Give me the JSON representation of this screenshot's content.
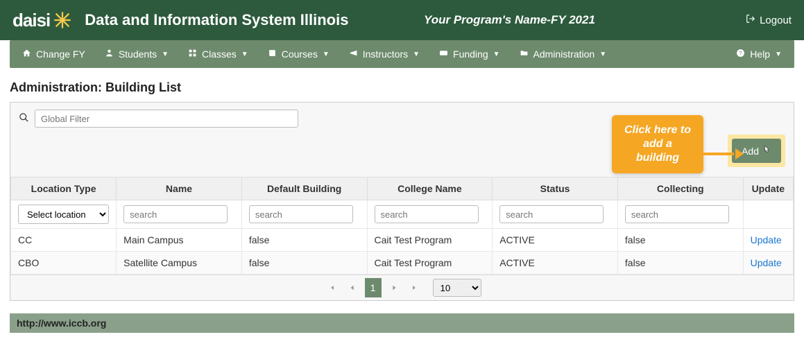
{
  "header": {
    "logo_text": "daisi",
    "app_title": "Data and Information System Illinois",
    "program_name": "Your Program's Name-FY 2021",
    "logout_label": "Logout"
  },
  "nav": {
    "change_fy": "Change FY",
    "students": "Students",
    "classes": "Classes",
    "courses": "Courses",
    "instructors": "Instructors",
    "funding": "Funding",
    "administration": "Administration",
    "help": "Help"
  },
  "page": {
    "title": "Administration: Building List"
  },
  "filter": {
    "global_placeholder": "Global Filter"
  },
  "callout": {
    "line1": "Click here to",
    "line2": "add a",
    "line3": "building"
  },
  "add_button_label": "Add",
  "table": {
    "headers": {
      "location_type": "Location Type",
      "name": "Name",
      "default_building": "Default Building",
      "college_name": "College Name",
      "status": "Status",
      "starting": "Collecting",
      "update": "Update"
    },
    "filter_row": {
      "select_location": "Select location",
      "search_placeholder": "search"
    },
    "rows": [
      {
        "location_type": "CC",
        "name": "Main Campus",
        "default_building": "false",
        "college_name": "Cait Test Program",
        "status": "ACTIVE",
        "starting": "false",
        "update": "Update"
      },
      {
        "location_type": "CBO",
        "name": "Satellite Campus",
        "default_building": "false",
        "college_name": "Cait Test Program",
        "status": "ACTIVE",
        "starting": "false",
        "update": "Update"
      }
    ]
  },
  "paginator": {
    "current_page": "1",
    "page_size": "10"
  },
  "footer": {
    "url": "http://www.iccb.org"
  }
}
